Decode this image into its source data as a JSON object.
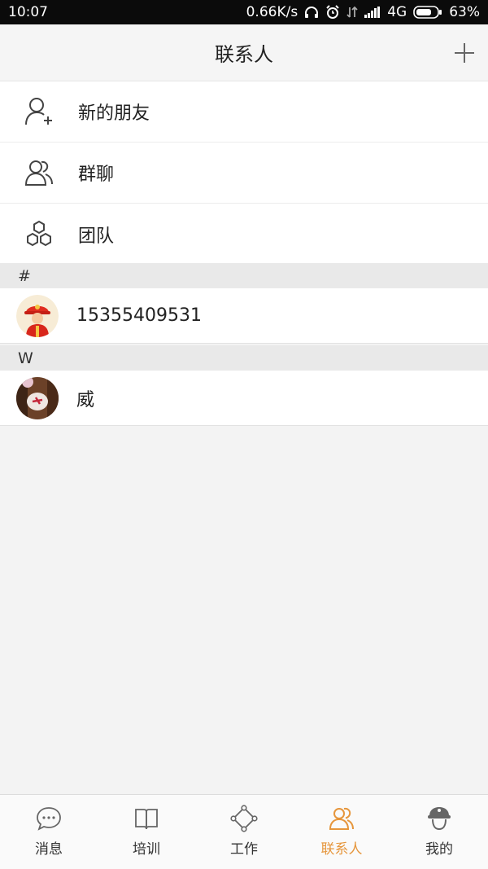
{
  "status_bar": {
    "time": "10:07",
    "speed": "0.66K/s",
    "network": "4G",
    "battery": "63%"
  },
  "header": {
    "title": "联系人",
    "add_icon": "plus-icon"
  },
  "menu": [
    {
      "label": "新的朋友",
      "icon": "add-person-icon"
    },
    {
      "label": "群聊",
      "icon": "group-icon"
    },
    {
      "label": "团队",
      "icon": "team-hexagon-icon"
    }
  ],
  "sections": [
    {
      "letter": "#",
      "contacts": [
        {
          "name": "15355409531",
          "avatar": "firefighter-avatar"
        }
      ]
    },
    {
      "letter": "W",
      "contacts": [
        {
          "name": "威",
          "avatar": "photo-avatar"
        }
      ]
    }
  ],
  "tabs": [
    {
      "label": "消息",
      "icon": "chat-bubble-icon",
      "active": false
    },
    {
      "label": "培训",
      "icon": "book-icon",
      "active": false
    },
    {
      "label": "工作",
      "icon": "diamond-nodes-icon",
      "active": false
    },
    {
      "label": "联系人",
      "icon": "contacts-icon",
      "active": true
    },
    {
      "label": "我的",
      "icon": "helmet-person-icon",
      "active": false
    }
  ],
  "colors": {
    "accent": "#e6963c",
    "icon_gray": "#666666",
    "background": "#f3f3f3"
  }
}
